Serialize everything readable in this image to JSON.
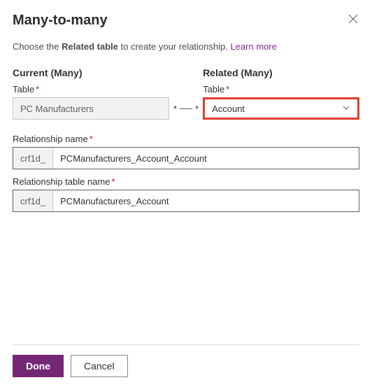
{
  "header": {
    "title": "Many-to-many"
  },
  "intro": {
    "pre": "Choose the ",
    "bold": "Related table",
    "post": " to create your relationship. ",
    "learn_more": "Learn more"
  },
  "current": {
    "section": "Current (Many)",
    "table_label": "Table",
    "table_value": "PC Manufacturers"
  },
  "related": {
    "section": "Related (Many)",
    "table_label": "Table",
    "table_value": "Account"
  },
  "connector": {
    "left": "*",
    "right": "*"
  },
  "rel_name": {
    "label": "Relationship name",
    "prefix": "crf1d_",
    "value": "PCManufacturers_Account_Account"
  },
  "rel_table_name": {
    "label": "Relationship table name",
    "prefix": "crf1d_",
    "value": "PCManufacturers_Account"
  },
  "required": "*",
  "footer": {
    "done": "Done",
    "cancel": "Cancel"
  }
}
